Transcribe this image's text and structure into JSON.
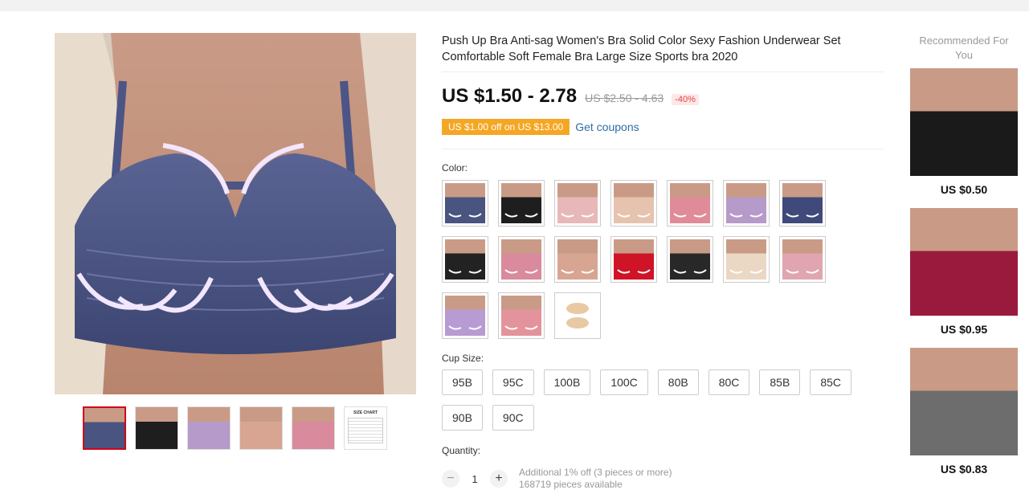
{
  "product": {
    "title": "Push Up Bra Anti-sag Women's Bra Solid Color Sexy Fashion Underwear Set Comfortable Soft Female Bra Large Size Sports bra 2020",
    "price": "US $1.50 - 2.78",
    "old_price": "US $2.50 - 4.63",
    "discount": "-40%"
  },
  "coupon": {
    "text": "US $1.00 off on US $13.00",
    "link": "Get coupons"
  },
  "color": {
    "label": "Color:",
    "swatches": [
      {
        "name": "navy",
        "color": "#4a5480"
      },
      {
        "name": "black",
        "color": "#1e1e1e"
      },
      {
        "name": "light-pink",
        "color": "#e8b8b8"
      },
      {
        "name": "beige",
        "color": "#e6c3ae"
      },
      {
        "name": "pink",
        "color": "#e08b98"
      },
      {
        "name": "lavender",
        "color": "#b69ac9"
      },
      {
        "name": "navy-2",
        "color": "#3f4a7a"
      },
      {
        "name": "black-2",
        "color": "#222222"
      },
      {
        "name": "rose",
        "color": "#d98a9c"
      },
      {
        "name": "nude",
        "color": "#d7a592"
      },
      {
        "name": "red",
        "color": "#cf1428"
      },
      {
        "name": "black-3",
        "color": "#282828"
      },
      {
        "name": "cream",
        "color": "#ead7c4"
      },
      {
        "name": "blush",
        "color": "#e0a5b0"
      },
      {
        "name": "purple",
        "color": "#b79bd2"
      },
      {
        "name": "salmon",
        "color": "#e2939b"
      },
      {
        "name": "nipple-cover",
        "color": "#e8c9a3"
      }
    ]
  },
  "cup_size": {
    "label": "Cup Size:",
    "options": [
      "95B",
      "95C",
      "100B",
      "100C",
      "80B",
      "80C",
      "85B",
      "85C",
      "90B",
      "90C"
    ]
  },
  "quantity": {
    "label": "Quantity:",
    "value": "1",
    "minus": "−",
    "plus": "+",
    "offer": "Additional 1% off (3 pieces or more)",
    "available": "168719 pieces available"
  },
  "recommended": {
    "title": "Recommended For You",
    "items": [
      {
        "price": "US $0.50",
        "color": "#1a1a1a"
      },
      {
        "price": "US $0.95",
        "color": "#9a1a3e"
      },
      {
        "price": "US $0.83",
        "color": "#6d6d6d"
      }
    ]
  },
  "gallery": {
    "main_color": "#4a5480",
    "size_chart_label": "SIZE CHART",
    "thumb_colors": [
      "#4a5480",
      "#1e1e1e",
      "#b69ac9",
      "#d7a592",
      "#d98a9c"
    ]
  }
}
